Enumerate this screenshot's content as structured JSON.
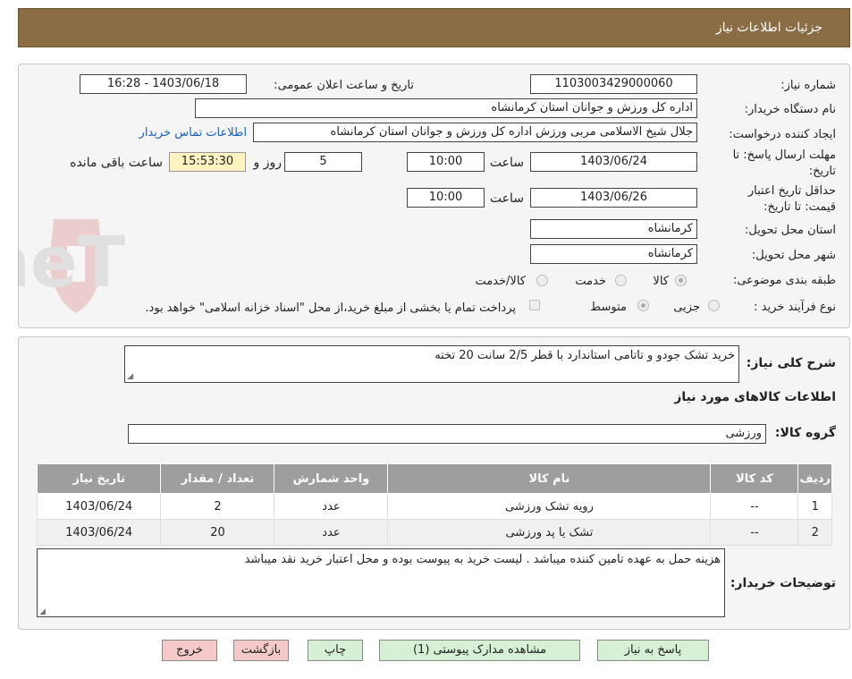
{
  "header": {
    "title": "جزئیات اطلاعات نیاز"
  },
  "form": {
    "need_number_label": "شماره نیاز:",
    "need_number": "1103003429000060",
    "announce_label": "تاریخ و ساعت اعلان عمومی:",
    "announce_value": "1403/06/18 - 16:28",
    "buyer_org_label": "نام دستگاه خریدار:",
    "buyer_org": "اداره کل ورزش و جوانان استان کرمانشاه",
    "creator_label": "ایجاد کننده درخواست:",
    "creator": "جلال شیخ الاسلامی مربی ورزش اداره کل ورزش و جوانان استان کرمانشاه",
    "contact_link": "اطلاعات تماس خریدار",
    "deadline_label_1": "مهلت ارسال پاسخ: تا",
    "deadline_label_2": "تاریخ:",
    "deadline_date": "1403/06/24",
    "time_label": "ساعت",
    "deadline_time": "10:00",
    "days": "5",
    "days_label": "روز و",
    "remaining_time": "15:53:30",
    "remaining_label": "ساعت باقی مانده",
    "validity_label_1": "حداقل تاریخ اعتبار",
    "validity_label_2": "قیمت: تا تاریخ:",
    "validity_date": "1403/06/26",
    "validity_time": "10:00",
    "province_label": "استان محل تحویل:",
    "province": "کرمانشاه",
    "city_label": "شهر محل تحویل:",
    "city": "کرمانشاه",
    "category_label": "طبقه بندی موضوعی:",
    "category_options": [
      "کالا",
      "خدمت",
      "کالا/خدمت"
    ],
    "category_selected": "کالا",
    "process_label": "نوع فرآیند خرید :",
    "process_options": [
      "جزیی",
      "متوسط"
    ],
    "process_selected": "متوسط",
    "payment_note": "پرداخت تمام یا بخشی از مبلغ خرید،از محل \"اسناد خزانه اسلامی\" خواهد بود."
  },
  "summary": {
    "label": "شرح کلی نیاز:",
    "value": "خرید تشک جودو و تاتامی استاندارد با قطر 2/5 سانت 20 تخته",
    "goods_info_title": "اطلاعات کالاهای مورد نیاز",
    "group_label": "گروه کالا:",
    "group_value": "ورزشی"
  },
  "table": {
    "headers": [
      "ردیف",
      "کد کالا",
      "نام کالا",
      "واحد شمارش",
      "تعداد / مقدار",
      "تاریخ نیاز"
    ],
    "rows": [
      [
        "1",
        "--",
        "رویه تشک ورزشی",
        "عدد",
        "2",
        "1403/06/24"
      ],
      [
        "2",
        "--",
        "تشک یا پد ورزشی",
        "عدد",
        "20",
        "1403/06/24"
      ]
    ]
  },
  "buyer_notes": {
    "label": "توضیحات خریدار:",
    "value": "هزینه حمل به عهده تامین کننده میباشد . لیست خرید به پیوست بوده و محل اعتبار خرید نقد میباشد"
  },
  "buttons": {
    "reply": "پاسخ به نیاز",
    "attachments": "مشاهده مدارک پیوستی (1)",
    "print": "چاپ",
    "back": "بازگشت",
    "exit": "خروج"
  },
  "watermark": {
    "text": "AriaTender.neT"
  },
  "colors": {
    "header_bg": "#8a6d45",
    "highlight": "#fdf3c0",
    "table_header": "#9e9e9e",
    "link": "#1a5fb4"
  }
}
